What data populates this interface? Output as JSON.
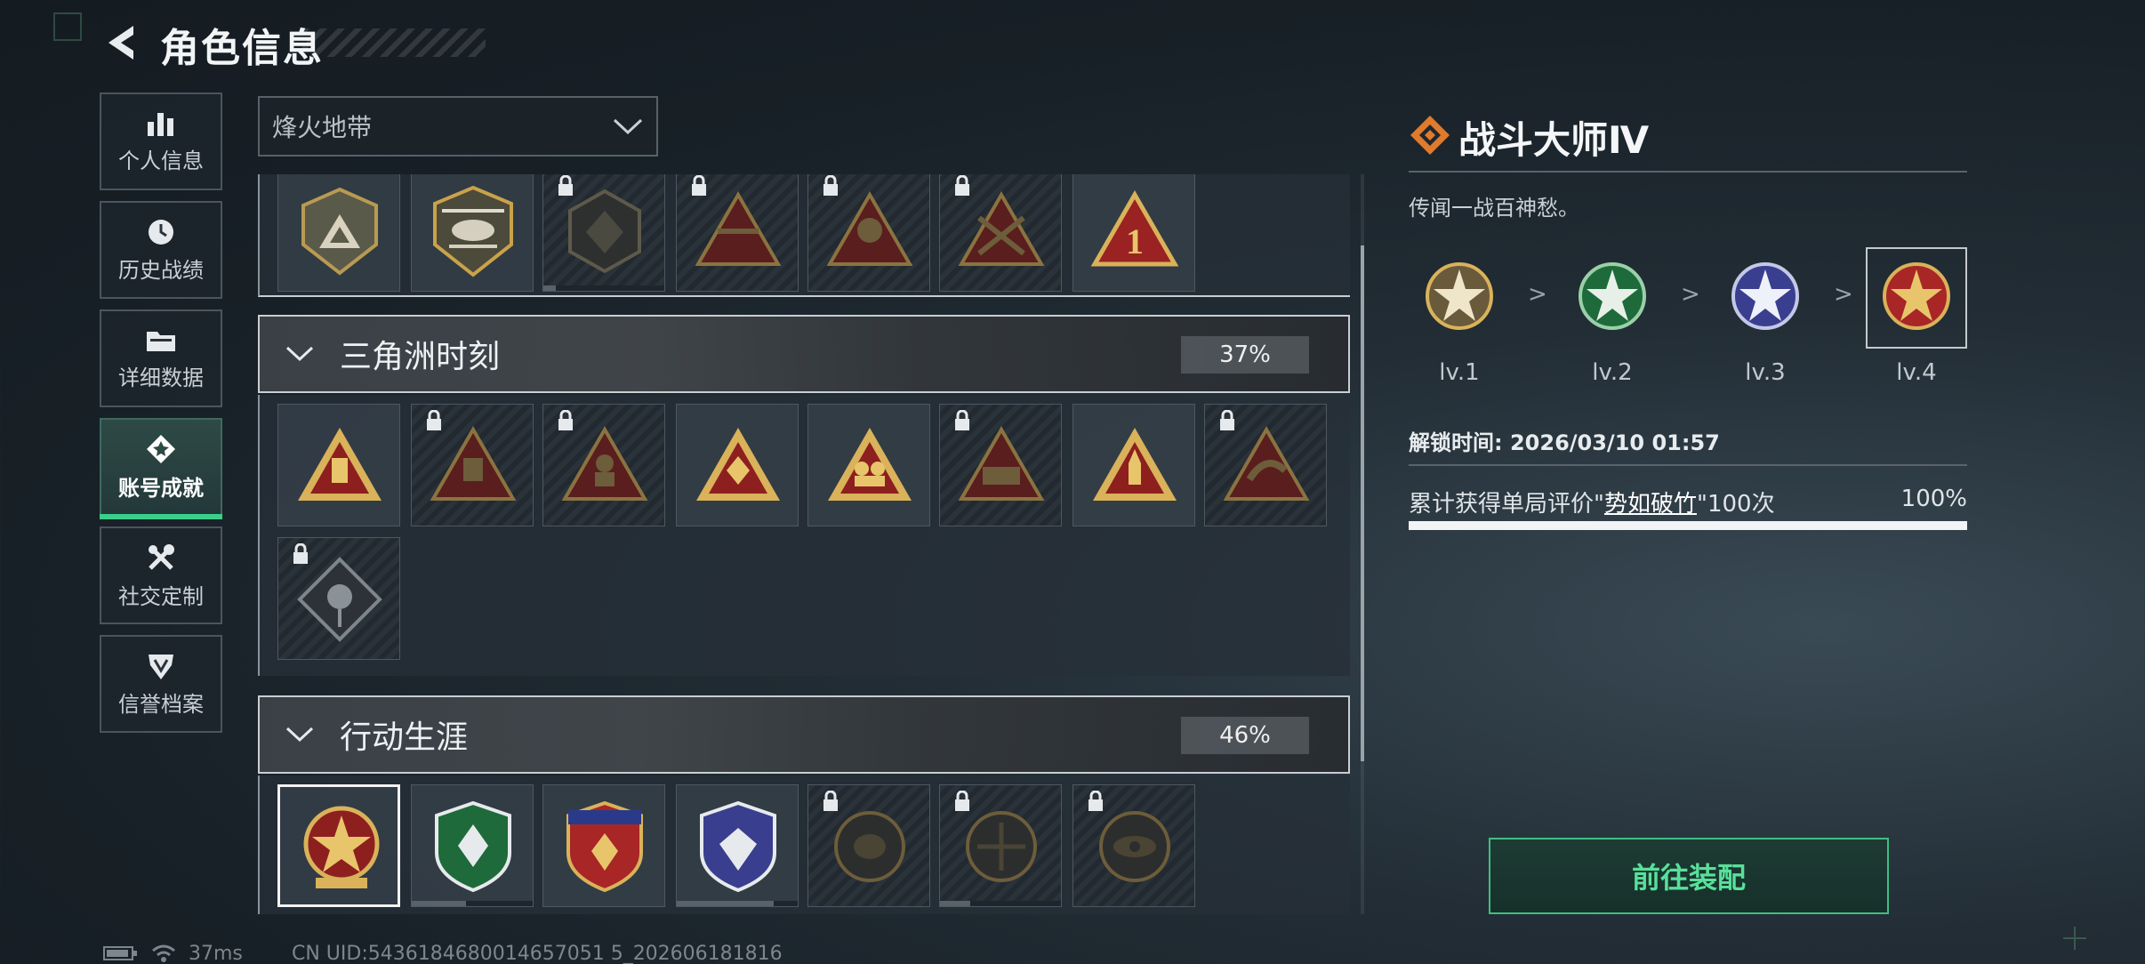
{
  "header": {
    "title": "角色信息"
  },
  "sidebar": {
    "items": [
      {
        "label": "个人信息",
        "icon": "bar-chart-icon"
      },
      {
        "label": "历史战绩",
        "icon": "history-clock-icon"
      },
      {
        "label": "详细数据",
        "icon": "folder-icon"
      },
      {
        "label": "账号成就",
        "icon": "achievement-icon",
        "active": true
      },
      {
        "label": "社交定制",
        "icon": "tools-icon"
      },
      {
        "label": "信誉档案",
        "icon": "reputation-icon"
      }
    ]
  },
  "filter": {
    "selected": "烽火地带"
  },
  "sections": [
    {
      "name": "三角洲时刻",
      "percent": "37%"
    },
    {
      "name": "行动生涯",
      "percent": "46%"
    }
  ],
  "detail": {
    "title": "战斗大师Ⅳ",
    "description": "传闻一战百神愁。",
    "levels": [
      "lv.1",
      "lv.2",
      "lv.3",
      "lv.4"
    ],
    "level_separator": ">",
    "unlock_label": "解锁时间:",
    "unlock_time": "2026/03/10 01:57",
    "requirement_prefix": "累计获得单局评价\"",
    "requirement_highlight": "势如破竹",
    "requirement_suffix": "\"100次",
    "requirement_percent": "100%",
    "progress": 1.0,
    "equip_button": "前往装配"
  },
  "status_bar": {
    "ping": "37ms",
    "uid": "CN UID:5436184680014657051 5_202606181816"
  },
  "colors": {
    "accent": "#3ad08a",
    "gold": "#c9a24a",
    "red_badge": "#8e1f1f"
  }
}
